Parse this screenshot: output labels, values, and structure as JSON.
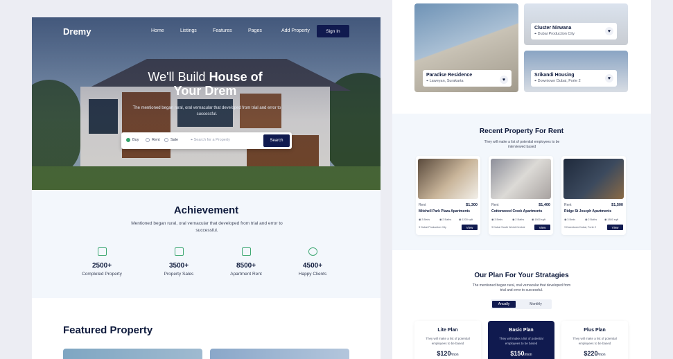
{
  "left": {
    "brand": "Dremy",
    "nav": [
      "Home",
      "Listings",
      "Features",
      "Pages",
      "Add Property"
    ],
    "sign_in": "Sign In",
    "hero_title_light": "We'll Build",
    "hero_title_bold": "House of",
    "hero_title_line2": "Your Drem",
    "hero_sub": "The mentioned began rural, oral vernacular that developed from trial and error to successful.",
    "search": {
      "options": [
        "Buy",
        "Rent",
        "Sale"
      ],
      "selected": "Buy",
      "placeholder": "Search for a Property",
      "button": "Search"
    },
    "achievement": {
      "title": "Achievement",
      "subtitle": "Mentioned began rural, oral vernacular that developed from trial and error to successful.",
      "stats": [
        {
          "value": "2500+",
          "label": "Completed Property"
        },
        {
          "value": "3500+",
          "label": "Property Sales"
        },
        {
          "value": "8500+",
          "label": "Apartment Rent"
        },
        {
          "value": "4500+",
          "label": "Happy Clients"
        }
      ]
    },
    "featured_title": "Featured Property"
  },
  "right": {
    "top_cards": [
      {
        "name": "Paradise Residence",
        "location": "Laweyan, Surakarta"
      },
      {
        "name": "Cluster Nirwana",
        "location": "Dubai Production City"
      },
      {
        "name": "Srikandi Housing",
        "location": "Downtown Dubai, Forte 2"
      }
    ],
    "rent": {
      "title": "Recent Property For Rent",
      "subtitle": "They will make a list of potential employees to be interviewed based",
      "cards": [
        {
          "kind": "Rent",
          "price": "$1,300",
          "name": "Mitchell Park Plaza Apartments",
          "beds": "3 Beds",
          "baths": "2 Baths",
          "area": "1200 sqft",
          "location": "Dubai Production City",
          "view": "View"
        },
        {
          "kind": "Rent",
          "price": "$1,400",
          "name": "Cottonwood Creek Apartments",
          "beds": "3 Beds",
          "baths": "2 Baths",
          "area": "1800 sqft",
          "location": "Dubai South World Central",
          "view": "View"
        },
        {
          "kind": "Rent",
          "price": "$1,500",
          "name": "Ridge St Joseph Apartments",
          "beds": "3 Beds",
          "baths": "2 Baths",
          "area": "1800 sqft",
          "location": "Downtown Dubai, Forte 2",
          "view": "View"
        }
      ]
    },
    "plans": {
      "title": "Our Plan For Your Stratagies",
      "subtitle": "The mentioned began rural, oral vernacular that developed from trial and error to successful.",
      "toggle": [
        "Anually",
        "Monthly"
      ],
      "items": [
        {
          "name": "Lite Plan",
          "desc": "They will make a list of potential employees to be based",
          "price": "$120",
          "per": "/mon"
        },
        {
          "name": "Basic Plan",
          "desc": "They will make a list of potential employees to be based",
          "price": "$150",
          "per": "/mon"
        },
        {
          "name": "Plus Plan",
          "desc": "They will make a list of potential employees to be based",
          "price": "$220",
          "per": "/mon"
        }
      ]
    }
  }
}
